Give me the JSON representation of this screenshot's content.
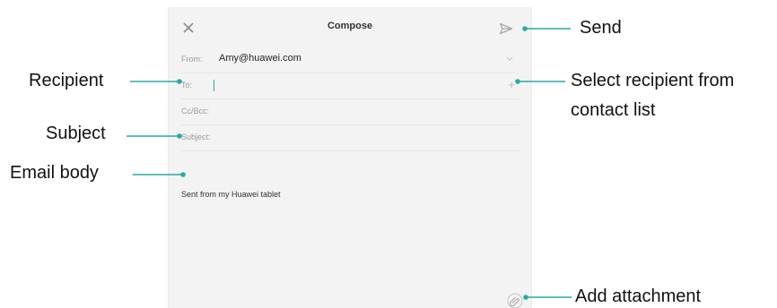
{
  "compose": {
    "title": "Compose",
    "from_label": "From:",
    "from_value": "Amy@huawei.com",
    "to_label": "To:",
    "cc_label": "Cc/Bcc:",
    "subject_label": "Subject:",
    "body_text": "Sent from my Huawei tablet",
    "add_symbol": "+"
  },
  "callouts": {
    "send": "Send",
    "recipient": "Recipient",
    "select_line1": "Select recipient from",
    "select_line2": "contact list",
    "subject": "Subject",
    "email_body": "Email body",
    "add_attachment": "Add attachment"
  },
  "colors": {
    "accent": "#2aa9a4",
    "screen_bg": "#f3f3f3"
  },
  "icons": [
    "close-icon",
    "send-icon",
    "chevron-down-icon",
    "add-icon",
    "paperclip-icon"
  ]
}
